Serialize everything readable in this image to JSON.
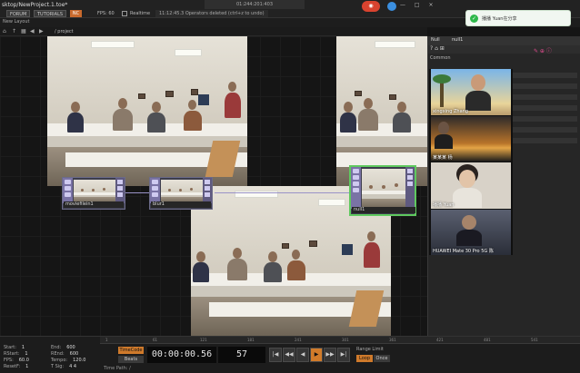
{
  "app": {
    "title": "sktop/NewProject.1.toe*"
  },
  "toolbar": {
    "forum": "FORUM",
    "tutorials": "TUTORIALS",
    "version_badge": "NC",
    "fps": "FPS:  60",
    "realtime": "Realtime",
    "status": "11:12:45.3 Operators deleted (ctrl+z to undo)",
    "window_icons": "— □ ×"
  },
  "call_banner": "01:244:201:403",
  "layout": {
    "label": "New Layout"
  },
  "path": {
    "text": "/ project"
  },
  "nodes": [
    {
      "label": "moviefilein1"
    },
    {
      "label": "blur1"
    },
    {
      "label": "null1"
    }
  ],
  "panel": {
    "tab1": "Null",
    "tab2": "null1",
    "tools": "? ⌂ ⊞",
    "pink": "✎ ⊕ ⓘ",
    "common": "Common"
  },
  "toast": {
    "icon": "✓",
    "text": "播播 Yuan在分享"
  },
  "tiles": [
    {
      "name": "xingxing Zhang"
    },
    {
      "name": "某某某 杨"
    },
    {
      "name": "播播 Yuan"
    },
    {
      "name": "HUAWEI Mate 30 Pro 5G 陈"
    }
  ],
  "range": {
    "start_label": "Start:",
    "start": "1",
    "end_label": "End:",
    "end": "600",
    "rstart_label": "RStart:",
    "rstart": "1",
    "rend_label": "REnd:",
    "rend": "600",
    "fps_label": "FPS:",
    "fps": "60.0",
    "tempo_label": "Tempo:",
    "tempo": "120.0",
    "resetf_label": "ResetF:",
    "resetf": "1",
    "tsig_label": "T Sig:",
    "tsig": "4   4"
  },
  "timeline": {
    "timecode_btn": "TimeCode",
    "beats_btn": "Beats",
    "timecode": "00:00:00.56",
    "frame": "57",
    "range_limit": "Range Limit",
    "loop": "Loop",
    "once": "Once",
    "path": "Time Path: /"
  },
  "ruler_ticks": [
    "1",
    "61",
    "121",
    "181",
    "241",
    "301",
    "361",
    "421",
    "481",
    "541"
  ],
  "transport": [
    "|◀",
    "◀◀",
    "◀",
    "▶",
    "▶▶",
    "▶|",
    "◀▶"
  ]
}
